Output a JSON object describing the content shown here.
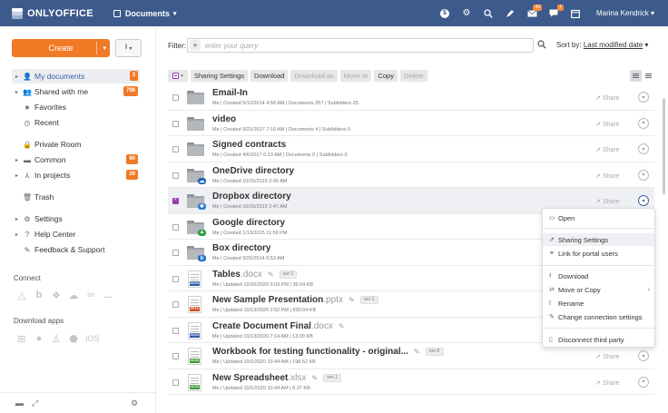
{
  "header": {
    "logo_text": "ONLYOFFICE",
    "module": "Documents",
    "user": "Marina Kendrick",
    "icons": [
      {
        "name": "payments-icon",
        "glyph": "$"
      },
      {
        "name": "settings-icon",
        "glyph": "⚙"
      },
      {
        "name": "search-icon",
        "glyph": "⌕"
      },
      {
        "name": "feed-icon",
        "glyph": "⚲"
      },
      {
        "name": "mail-icon",
        "glyph": "✉",
        "badge": "40"
      },
      {
        "name": "chat-icon",
        "glyph": "▭",
        "badge": "1"
      },
      {
        "name": "calendar-icon",
        "glyph": "▦"
      }
    ]
  },
  "sidebar": {
    "create_label": "Create",
    "items": [
      {
        "label": "My documents",
        "count": "3"
      },
      {
        "label": "Shared with me",
        "count": "798"
      },
      {
        "label": "Favorites"
      },
      {
        "label": "Recent"
      },
      {
        "label": "Private Room"
      },
      {
        "label": "Common",
        "count": "60"
      },
      {
        "label": "In projects",
        "count": "29"
      },
      {
        "label": "Trash"
      },
      {
        "label": "Settings"
      },
      {
        "label": "Help Center"
      },
      {
        "label": "Feedback & Support"
      }
    ],
    "connect_title": "Connect",
    "download_title": "Download apps",
    "ios_label": "iOS",
    "more_label": "..."
  },
  "filter": {
    "label": "Filter:",
    "placeholder": "enter your query",
    "sort_prefix": "Sort by:",
    "sort_value": "Last modified date"
  },
  "toolbar": {
    "sharing_settings": "Sharing Settings",
    "download": "Download",
    "download_as": "Download as",
    "move_to": "Move to",
    "copy": "Copy",
    "delete": "Delete"
  },
  "rows": [
    {
      "name": "Email-In",
      "meta": "Me | Created 5/12/2014 4:58 AM | Documents 257 | Subfolders 25"
    },
    {
      "name": "video",
      "meta": "Me | Created 9/21/2017 7:10 AM | Documents 4 | Subfolders 0"
    },
    {
      "name": "Signed contracts",
      "meta": "Me | Created 4/6/2017 6:13 AM | Documents 0 | Subfolders 0"
    },
    {
      "name": "OneDrive directory",
      "meta": "Me | Created 10/15/2015 2:45 AM"
    },
    {
      "name": "Dropbox directory",
      "meta": "Me | Created 10/15/2015 2:47 AM"
    },
    {
      "name": "Google directory",
      "meta": "Me | Created 1/13/2015 11:59 PM"
    },
    {
      "name": "Box directory",
      "meta": "Me | Created 9/25/2014 6:53 AM"
    },
    {
      "name": "Tables",
      "ext": ".docx",
      "ver": "ver.1",
      "meta": "Me | Updated 10/20/2020 3:03 PM | 35.04 KB",
      "tag": "DOCX"
    },
    {
      "name": "New Sample Presentation",
      "ext": ".pptx",
      "ver": "ver.1",
      "meta": "Me | Updated 10/13/2020 2:52 PM | 830.04 KB",
      "tag": "PPTX"
    },
    {
      "name": "Create Document Final",
      "ext": ".docx",
      "meta": "Me | Updated 10/13/2020 7:14 AM | 13.09 KB",
      "tag": "DOCX"
    },
    {
      "name": "Workbook for testing functionality - original...",
      "ver": "ver.6",
      "meta": "Me | Updated 10/1/2020 10:44 AM | 198.52 KB",
      "tag": "XLSX"
    },
    {
      "name": "New Spreadsheet",
      "ext": ".xlsx",
      "ver": "ver.1",
      "meta": "Me | Updated 10/1/2020 10:44 AM | 8.37 KB",
      "tag": "XLSX"
    }
  ],
  "share_label": "Share",
  "context_menu": {
    "open": "Open",
    "sharing_settings": "Sharing Settings",
    "link_portal": "Link for portal users",
    "download": "Download",
    "move_copy": "Move or Copy",
    "rename": "Rename",
    "change_conn": "Change connection settings",
    "disconnect": "Disconnect third party"
  },
  "colors": {
    "header": "#3d5a8c",
    "accent": "#f07a26",
    "checkbox": "#9b3cb0",
    "docx": "#2a5ca8",
    "pptx": "#d14d1f",
    "xlsx": "#3e9a3a"
  }
}
